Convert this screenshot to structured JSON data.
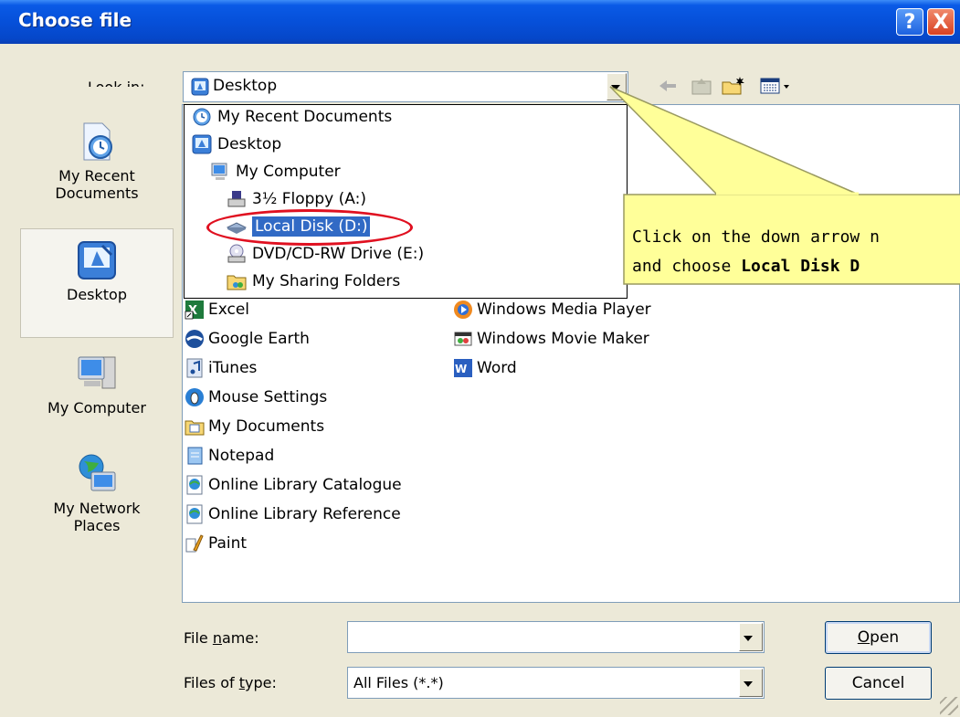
{
  "window": {
    "title": "Choose file",
    "help_label": "?",
    "close_label": "X"
  },
  "look_in": {
    "label_pre": "Look ",
    "label_accel": "i",
    "label_post": "n:",
    "value": "Desktop"
  },
  "places": [
    {
      "line1": "My Recent",
      "line2": "Documents",
      "icon": "recent-documents-icon"
    },
    {
      "line1": "Desktop",
      "line2": "",
      "icon": "desktop-icon"
    },
    {
      "line1": "My Computer",
      "line2": "",
      "icon": "my-computer-icon"
    },
    {
      "line1": "My Network",
      "line2": "Places",
      "icon": "network-places-icon"
    }
  ],
  "dropdown": {
    "items": [
      {
        "label": "My Recent Documents",
        "icon": "recent-documents-icon"
      },
      {
        "label": "Desktop",
        "icon": "desktop-icon"
      },
      {
        "label": "My Computer",
        "icon": "my-computer-icon"
      },
      {
        "label": "3½ Floppy (A:)",
        "icon": "floppy-drive-icon"
      },
      {
        "label": "Local Disk (D:)",
        "icon": "hard-disk-icon",
        "selected": true
      },
      {
        "label": "DVD/CD-RW Drive (E:)",
        "icon": "dvd-drive-icon"
      },
      {
        "label": "My Sharing Folders",
        "icon": "shared-folder-icon"
      }
    ]
  },
  "files": {
    "col1": [
      "Excel",
      "Google Earth",
      "iTunes",
      "Mouse Settings",
      "My Documents",
      "Notepad",
      "Online Library Catalogue",
      "Online Library Reference",
      "Paint"
    ],
    "col2": [
      "Windows Media Player",
      "Windows Movie Maker",
      "Word"
    ]
  },
  "callout": {
    "line1": "Click on the down arrow n",
    "line2_pre": "and choose ",
    "line2_bold": "Local Disk D"
  },
  "file_name": {
    "label_pre": "File ",
    "label_accel": "n",
    "label_post": "ame:",
    "value": ""
  },
  "file_type": {
    "label_pre": "Files of ",
    "label_accel": "t",
    "label_post": "ype:",
    "value": "All Files (*.*)"
  },
  "buttons": {
    "open_accel": "O",
    "open_rest": "pen",
    "cancel": "Cancel"
  },
  "colors": {
    "titlebar": "#0650d9",
    "selection": "#316ac5",
    "callout_fill": "#ffff99",
    "oval": "#e01020"
  }
}
